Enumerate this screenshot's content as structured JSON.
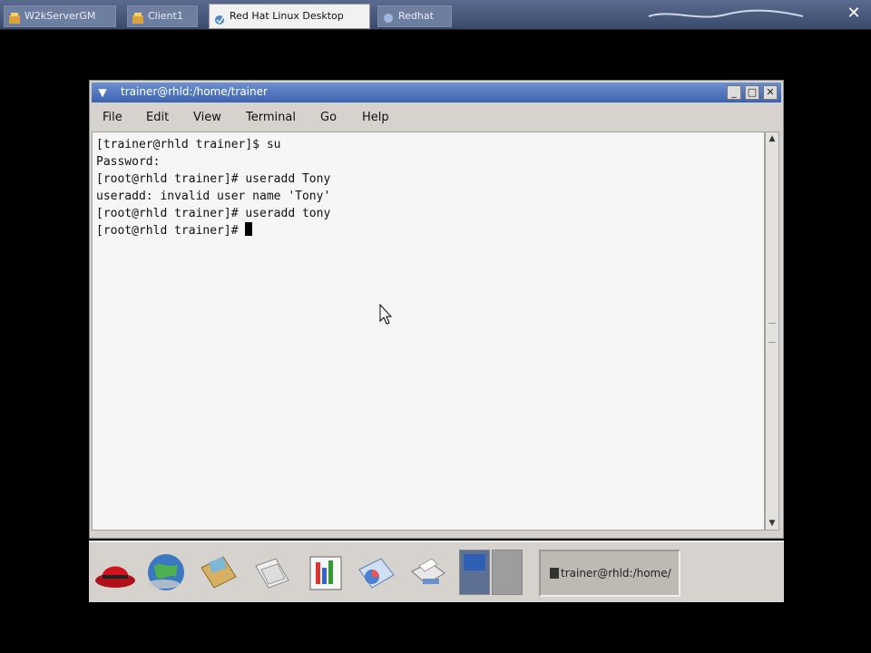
{
  "host": {
    "tabs": [
      {
        "label": "W2kServerGM",
        "active": false
      },
      {
        "label": "Client1",
        "active": false
      },
      {
        "label": "Red Hat Linux Desktop",
        "active": true
      },
      {
        "label": "Redhat",
        "active": false
      }
    ],
    "right_text": "~~~"
  },
  "window": {
    "title": "trainer@rhld:/home/trainer",
    "controls": {
      "minimize": "_",
      "maximize": "□",
      "close": "✕"
    }
  },
  "menu": [
    "File",
    "Edit",
    "View",
    "Terminal",
    "Go",
    "Help"
  ],
  "terminal": {
    "lines": [
      "[trainer@rhld trainer]$ su",
      "Password:",
      "[root@rhld trainer]# useradd Tony",
      "useradd: invalid user name 'Tony'",
      "[root@rhld trainer]# useradd tony",
      "[root@rhld trainer]# "
    ]
  },
  "panel": {
    "launchers": [
      "redhat-menu-icon",
      "web-browser-icon",
      "mail-icon",
      "file-manager-icon",
      "office-writer-icon",
      "spreadsheet-icon",
      "printer-icon"
    ],
    "taskbar_button": "trainer@rhld:/home/"
  },
  "colors": {
    "titlebar": "#4a70bd",
    "terminal_bg": "#f6f6f6",
    "panel_bg": "#d6d3ce"
  }
}
